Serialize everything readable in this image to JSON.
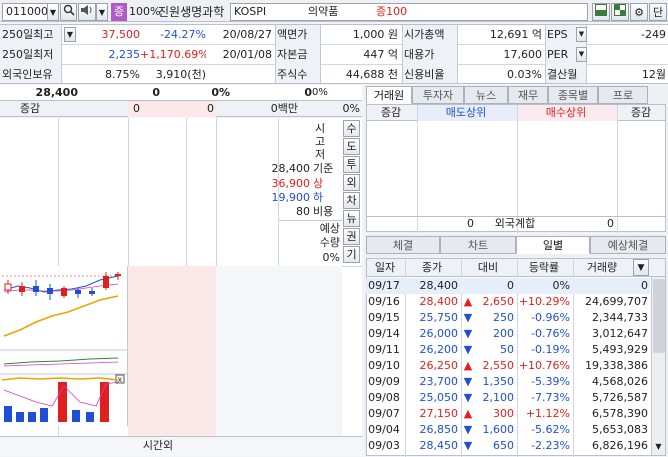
{
  "toolbar": {
    "code": "011000",
    "zoom": "100%",
    "badge": "증",
    "company": "진원생명과학",
    "market": "KOSPI",
    "sector": "의약품",
    "margin": "증100",
    "gear_label": "⚙",
    "single_label": "단"
  },
  "info": {
    "rows": [
      {
        "label": "250일최고",
        "val": "37,500",
        "pct": "-24.27%",
        "date": "20/08/27",
        "k1": "액면가",
        "v1": "1,000 원",
        "k2": "시가총액",
        "v2": "12,691 억",
        "k3": "EPS",
        "v3": "-249"
      },
      {
        "label": "250일최저",
        "val": "2,235",
        "pct": "+1,170.69%",
        "date": "20/01/08",
        "k1": "자본금",
        "v1": "447 억",
        "k2": "대용가",
        "v2": "17,600",
        "k3": "PER",
        "v3": ""
      },
      {
        "label": "외국인보유",
        "val": "8.75%",
        "pct": "3,910(천)",
        "date": "",
        "k1": "주식수",
        "v1": "44,688 천",
        "k2": "신용비율",
        "v2": "0.03%",
        "k3": "결산월",
        "v3": "12월"
      }
    ]
  },
  "quote": {
    "price": "28,400",
    "change": "0",
    "pct": "0%",
    "volume": "0",
    "vol_unit": "0%",
    "sub_label": "증감",
    "sub_v1": "0",
    "sub_v2": "0",
    "sub_amount": "0백만",
    "sub_pct": "0%"
  },
  "orderbook": {
    "ref_label": "시\n고\n저",
    "ref_price": "28,400",
    "ref_tag": "기준",
    "upper": "36,900",
    "upper_tag": "상",
    "lower": "19,900",
    "lower_tag": "하",
    "ratio": "80",
    "ratio_tag": "비용",
    "expected_label": "예상",
    "expected_qty": "수량",
    "expected_pct": "0%",
    "side_buttons": [
      "수",
      "도",
      "투",
      "외",
      "차",
      "뉴",
      "권",
      "기"
    ],
    "after_hours": "시간외"
  },
  "broker": {
    "tabs": [
      "거래원",
      "투자자",
      "뉴스",
      "재무",
      "종목별",
      "프로"
    ],
    "headers": [
      "증감",
      "매도상위",
      "매수상위",
      "증감"
    ],
    "foreign_sell": "0",
    "foreign_label": "외국계합",
    "foreign_buy": "0"
  },
  "daily": {
    "tabs": [
      "체결",
      "차트",
      "일별",
      "예상체결"
    ],
    "headers": [
      "일자",
      "종가",
      "대비",
      "등락률",
      "거래량"
    ],
    "rows": [
      {
        "date": "09/17",
        "close": "28,400",
        "dir": "",
        "chg": "0",
        "pct": "0%",
        "vol": "0",
        "color": "black"
      },
      {
        "date": "09/16",
        "close": "28,400",
        "dir": "▲",
        "chg": "2,650",
        "pct": "+10.29%",
        "vol": "24,699,707",
        "color": "red"
      },
      {
        "date": "09/15",
        "close": "25,750",
        "dir": "▼",
        "chg": "250",
        "pct": "-0.96%",
        "vol": "2,344,733",
        "color": "blue"
      },
      {
        "date": "09/14",
        "close": "26,000",
        "dir": "▼",
        "chg": "200",
        "pct": "-0.76%",
        "vol": "3,012,647",
        "color": "blue"
      },
      {
        "date": "09/11",
        "close": "26,200",
        "dir": "▼",
        "chg": "50",
        "pct": "-0.19%",
        "vol": "5,493,929",
        "color": "blue"
      },
      {
        "date": "09/10",
        "close": "26,250",
        "dir": "▲",
        "chg": "2,550",
        "pct": "+10.76%",
        "vol": "19,338,386",
        "color": "red"
      },
      {
        "date": "09/09",
        "close": "23,700",
        "dir": "▼",
        "chg": "1,350",
        "pct": "-5.39%",
        "vol": "4,568,026",
        "color": "blue"
      },
      {
        "date": "09/08",
        "close": "25,050",
        "dir": "▼",
        "chg": "2,100",
        "pct": "-7.73%",
        "vol": "5,726,587",
        "color": "blue"
      },
      {
        "date": "09/07",
        "close": "27,150",
        "dir": "▲",
        "chg": "300",
        "pct": "+1.12%",
        "vol": "6,578,390",
        "color": "red"
      },
      {
        "date": "09/04",
        "close": "26,850",
        "dir": "▼",
        "chg": "1,600",
        "pct": "-5.62%",
        "vol": "5,653,083",
        "color": "blue"
      },
      {
        "date": "09/03",
        "close": "28,450",
        "dir": "▼",
        "chg": "650",
        "pct": "-2.23%",
        "vol": "6,826,196",
        "color": "blue"
      }
    ]
  },
  "colors": {
    "up": "#e0201c",
    "down": "#1f4fd6",
    "accent": "#b05cc8"
  }
}
